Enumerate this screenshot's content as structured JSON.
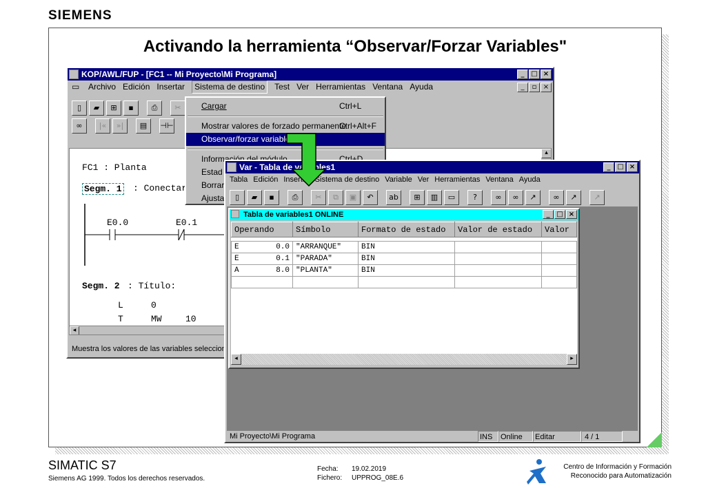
{
  "brand": "SIEMENS",
  "slide_title": "Activando la herramienta “Observar/Forzar Variables\"",
  "main_window": {
    "title": "KOP/AWL/FUP  - [FC1 -- Mi Proyecto\\Mi Programa]",
    "menus": [
      "Archivo",
      "Edición",
      "Insertar",
      "Sistema de destino",
      "Test",
      "Ver",
      "Herramientas",
      "Ventana",
      "Ayuda"
    ],
    "code": {
      "block": "FC1 : Planta",
      "seg1_label": "Segm. 1",
      "seg1_title": ": Conectar/",
      "contact1": "E0.0",
      "contact2": "E0.1",
      "seg2_label": "Segm. 2",
      "seg2_title": ": Título:",
      "lines": [
        {
          "op": "L",
          "arg": "0",
          "val": ""
        },
        {
          "op": "T",
          "arg": "MW",
          "val": "10"
        }
      ]
    },
    "status": "Muestra los valores de las variables seleccion"
  },
  "dropdown": {
    "items": [
      {
        "label": "Cargar",
        "shortcut": "Ctrl+L"
      },
      {
        "label": "Mostrar valores de forzado permanente",
        "shortcut": "Ctrl+Alt+F"
      },
      {
        "label": "Observar/forzar variable",
        "shortcut": ""
      },
      {
        "label": "Información del módulo",
        "shortcut": "Ctrl+D"
      },
      {
        "label": "Estad",
        "shortcut": ""
      },
      {
        "label": "Borrar",
        "shortcut": ""
      },
      {
        "label": "Ajusta",
        "shortcut": ""
      }
    ]
  },
  "var_window": {
    "title": "Var - Tabla de variables1",
    "menus": [
      "Tabla",
      "Edición",
      "Insertar",
      "Sistema de destino",
      "Variable",
      "Ver",
      "Herramientas",
      "Ventana",
      "Ayuda"
    ],
    "status": {
      "path": "Mi Proyecto\\Mi Programa",
      "ins": "INS",
      "mode": "Online",
      "edit": "Editar",
      "page": "4 / 1"
    }
  },
  "table_window": {
    "title": "Tabla de variables1  ONLINE",
    "headers": [
      "Operando",
      "Símbolo",
      "Formato de estado",
      "Valor de estado",
      "Valor"
    ],
    "rows": [
      [
        "E",
        "0.0",
        "\"ARRANQUE\"",
        "BIN",
        "",
        ""
      ],
      [
        "E",
        "0.1",
        "\"PARADA\"",
        "BIN",
        "",
        ""
      ],
      [
        "A",
        "8.0",
        "\"PLANTA\"",
        "BIN",
        "",
        ""
      ]
    ]
  },
  "footer": {
    "product": "SIMATIC S7",
    "copyright": "Siemens AG 1999. Todos los derechos reservados.",
    "fecha_label": "Fecha:",
    "fecha": "19.02.2019",
    "fichero_label": "Fichero:",
    "fichero": "UPPROG_08E.6",
    "center_line1": "Centro de Información y Formación",
    "center_line2": "Reconocido para Automatización"
  },
  "colors": {
    "titlebar": "#000080",
    "highlight": "#000080",
    "window_face": "#c0c0c0",
    "arrow": "#33cc33",
    "table_title": "#00ffff"
  }
}
